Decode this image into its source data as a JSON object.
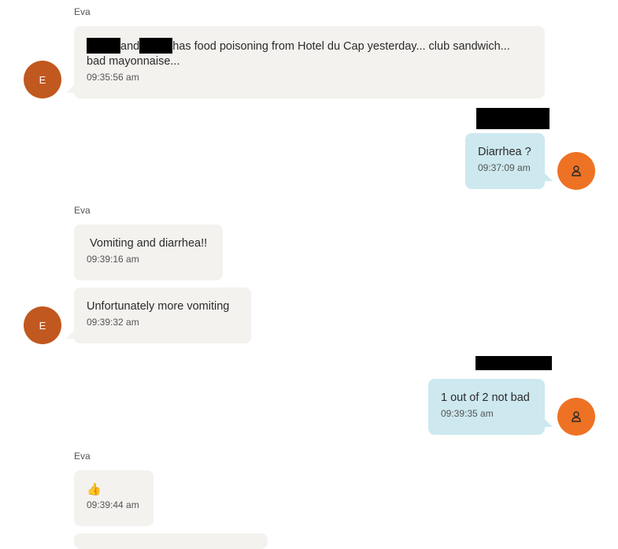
{
  "contact": {
    "name": "Eva",
    "avatar_initial": "E"
  },
  "user": {
    "avatar_icon": "person-icon"
  },
  "colors": {
    "incoming_bubble": "#f3f2ef",
    "outgoing_bubble": "#cde8ef",
    "contact_avatar": "#c0581f",
    "user_avatar": "#ee7224"
  },
  "messages": [
    {
      "direction": "incoming",
      "sender": "Eva",
      "text_parts": [
        "and",
        "has food poisoning from Hotel du Cap yesterday... club sandwich...",
        "bad mayonnaise..."
      ],
      "redacted_segments": 2,
      "time": "09:35:56 am"
    },
    {
      "direction": "outgoing",
      "sender_redacted": true,
      "text": "Diarrhea ?",
      "time": "09:37:09 am"
    },
    {
      "direction": "incoming",
      "sender": "Eva",
      "text": " Vomiting and diarrhea!!",
      "time": "09:39:16 am"
    },
    {
      "direction": "incoming",
      "text": "Unfortunately more vomiting",
      "time": "09:39:32 am"
    },
    {
      "direction": "outgoing",
      "sender_redacted": true,
      "text": "1 out of 2 not bad",
      "time": "09:39:35 am"
    },
    {
      "direction": "incoming",
      "sender": "Eva",
      "text": "👍",
      "icon": "thumbs-up-icon",
      "time": "09:39:44 am"
    }
  ]
}
